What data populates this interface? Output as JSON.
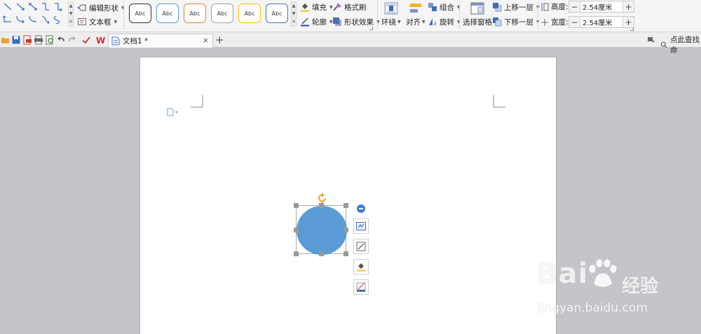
{
  "ribbon": {
    "edit_shape_label": "编辑形状",
    "textbox_label": "文本框",
    "style_presets": [
      "Abc",
      "Abc",
      "Abc",
      "Abc",
      "Abc",
      "Abc"
    ],
    "style_preset_colors": [
      "#333333",
      "#5b9bd5",
      "#ed7d31",
      "#a5a5a5",
      "#ffc000",
      "#4472c4"
    ],
    "fill_label": "填充",
    "format_painter_label": "格式刷",
    "outline_label": "轮廓",
    "shape_effects_label": "形状效果",
    "wrap_label": "环绕",
    "align_label": "对齐",
    "group_label": "组合",
    "rotate_label": "旋转",
    "selection_pane_label": "选择窗格",
    "bring_forward_label": "上移一层",
    "send_backward_label": "下移一层",
    "height_label": "高度:",
    "height_value": "2.54厘米",
    "width_label": "宽度:",
    "width_value": "2.54厘米"
  },
  "tabbar": {
    "doc_tab_title": "文档1 *",
    "close_symbol": "×",
    "add_symbol": "+",
    "search_help_label": "点此查找命"
  },
  "watermark": {
    "brand": "Bai",
    "brand_cn": "经验",
    "url": "jingyan.baidu.com"
  },
  "colors": {
    "shape_fill": "#5b9bd5",
    "selection_handle": "#9a9a9a",
    "rotate_handle": "#f0a030",
    "accent_blue": "#3b7dd8"
  }
}
